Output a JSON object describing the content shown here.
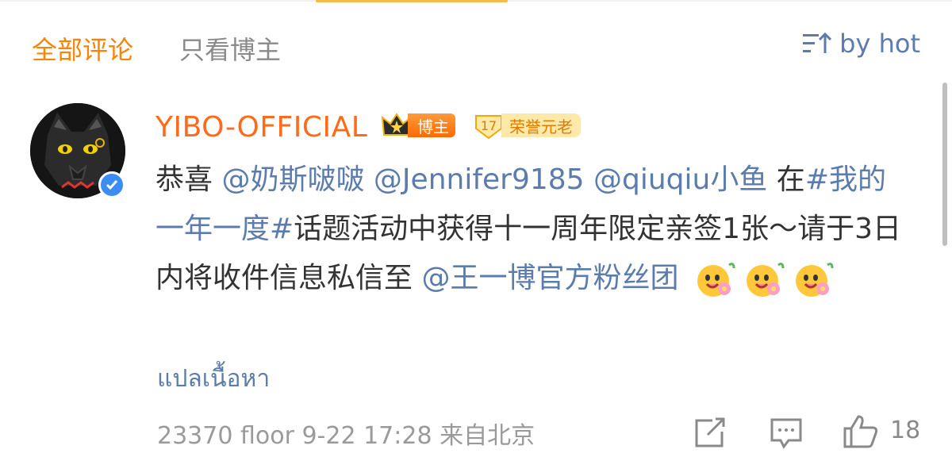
{
  "tabs": {
    "all_comments": "全部评论",
    "owner_only": "只看博主"
  },
  "sort": {
    "label": "by hot",
    "icon": "sort-icon"
  },
  "comment": {
    "username": "YIBO-OFFICIAL",
    "badge_owner": "博主",
    "badge_honor_level": "17",
    "badge_honor": "荣誉元老",
    "text_prefix": "恭喜 ",
    "mention_1": "@奶斯啵啵",
    "mention_2": "@Jennifer9185",
    "mention_3": "@qiuqiu小鱼",
    "text_mid_1": " 在",
    "topic": "#我的一年一度#",
    "text_mid_2": "话题活动中获得十一周年限定亲签1张～请于3日内将收件信息私信至",
    "mention_4": "@王一博官方粉丝团",
    "emoji_name": "flower-emoji",
    "translate": "แปลเนื้อหา",
    "floor": "23370 floor",
    "time": "9-22 17:28",
    "location": "来自北京",
    "like_count": "18"
  },
  "colors": {
    "accent": "#ff8200",
    "username": "#ff6b1a",
    "link": "#5b7cac",
    "text": "#333333",
    "muted": "#9a9a9a",
    "verified": "#3a8df5"
  }
}
